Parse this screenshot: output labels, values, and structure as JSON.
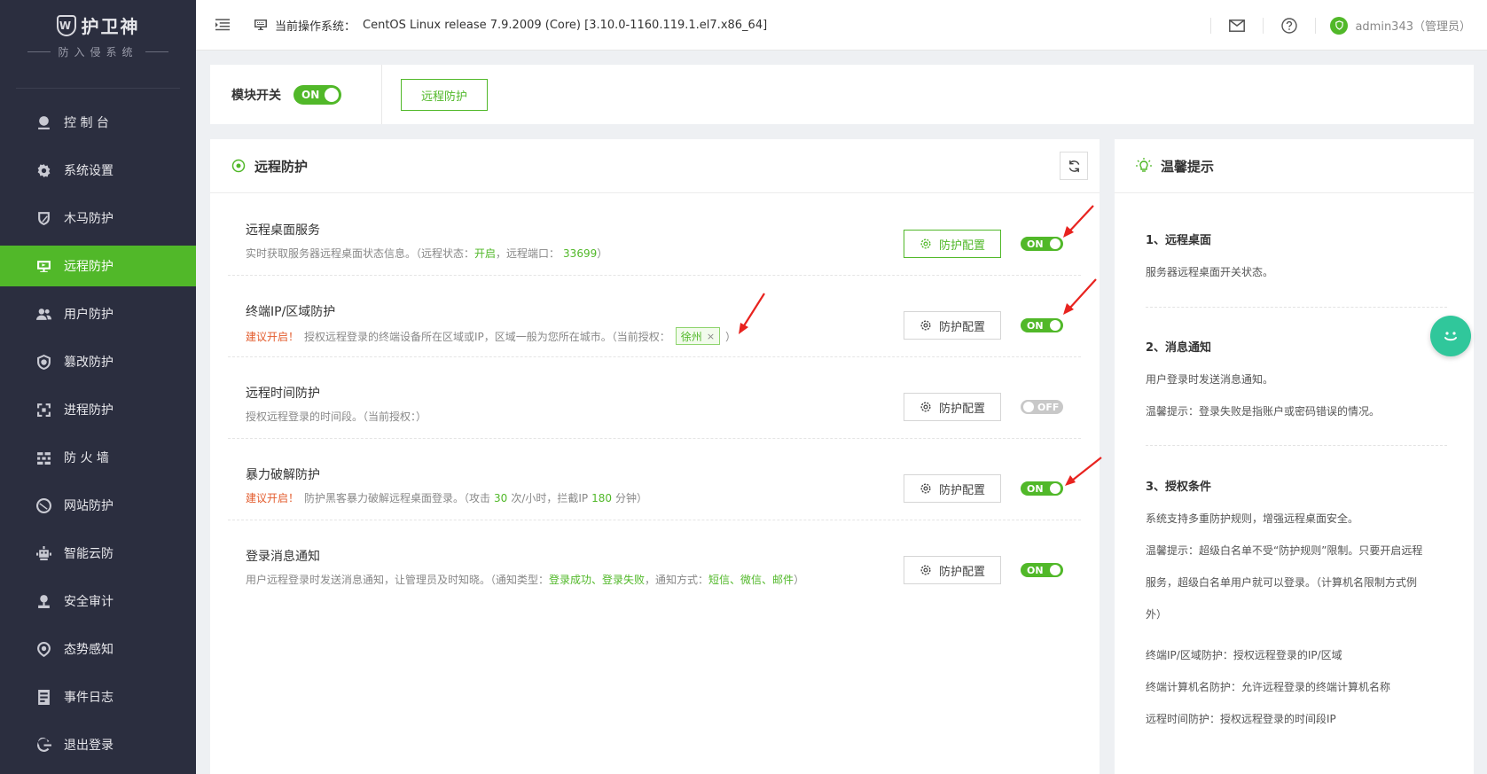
{
  "sidebar": {
    "logo_title": "护卫神",
    "logo_mark": "W",
    "logo_sub": "防入侵系统",
    "items": [
      {
        "label": "控 制 台",
        "icon": "dashboard-icon"
      },
      {
        "label": "系统设置",
        "icon": "gear-icon"
      },
      {
        "label": "木马防护",
        "icon": "trojan-shield-icon"
      },
      {
        "label": "远程防护",
        "icon": "remote-desktop-icon",
        "active": true
      },
      {
        "label": "用户防护",
        "icon": "users-icon"
      },
      {
        "label": "篡改防护",
        "icon": "tamper-icon"
      },
      {
        "label": "进程防护",
        "icon": "process-icon"
      },
      {
        "label": "防 火 墙",
        "icon": "firewall-icon"
      },
      {
        "label": "网站防护",
        "icon": "website-icon"
      },
      {
        "label": "智能云防",
        "icon": "cloud-robot-icon"
      },
      {
        "label": "安全审计",
        "icon": "audit-icon"
      },
      {
        "label": "态势感知",
        "icon": "situation-icon"
      },
      {
        "label": "事件日志",
        "icon": "log-icon"
      },
      {
        "label": "退出登录",
        "icon": "logout-icon"
      }
    ]
  },
  "topbar": {
    "os_label": "当前操作系统：",
    "os_value": "CentOS Linux release 7.9.2009 (Core) [3.10.0-1160.119.1.el7.x86_64]",
    "user": "admin343（管理员）"
  },
  "module": {
    "label": "模块开关",
    "toggle": "ON",
    "tab": "远程防护"
  },
  "panel": {
    "title": "远程防护",
    "config_label": "防护配置",
    "services": [
      {
        "name": "远程桌面服务",
        "desc_a": "实时获取服务器远程桌面状态信息。（远程状态：",
        "status": "开启",
        "desc_b": "，远程端口：",
        "port": "33699",
        "desc_c": "）",
        "toggle": "ON"
      },
      {
        "name": "终端IP/区域防护",
        "warn": "建议开启！",
        "desc_a": "授权远程登录的终端设备所在区域或IP，区域一般为您所在城市。（当前授权：",
        "tag": "徐州",
        "tag_x": "×",
        "desc_c": "）",
        "toggle": "ON"
      },
      {
        "name": "远程时间防护",
        "desc_a": "授权远程登录的时间段。（当前授权：）",
        "toggle": "OFF"
      },
      {
        "name": "暴力破解防护",
        "warn": "建议开启！",
        "desc_a": "防护黑客暴力破解远程桌面登录。（攻击",
        "n1": "30",
        "desc_b": "次/小时，拦截IP",
        "n2": "180",
        "desc_c": "分钟）",
        "toggle": "ON"
      },
      {
        "name": "登录消息通知",
        "desc_a": "用户远程登录时发送消息通知，让管理员及时知晓。（通知类型：",
        "types": "登录成功、登录失败",
        "desc_b": "，通知方式：",
        "ways": "短信、微信、邮件",
        "desc_c": "）",
        "toggle": "ON"
      }
    ]
  },
  "tips": {
    "title": "温馨提示",
    "s1_h": "1、远程桌面",
    "s1_p1": "服务器远程桌面开关状态。",
    "s2_h": "2、消息通知",
    "s2_p1": "用户登录时发送消息通知。",
    "s2_p2": "温馨提示：登录失败是指账户或密码错误的情况。",
    "s3_h": "3、授权条件",
    "s3_p1": "系统支持多重防护规则，增强远程桌面安全。",
    "s3_p2a": "温馨提示：超级白名单不受“防护规则”限制。只要开启远程",
    "s3_p2b": "服务，超级白名单用户就可以登录。（计算机名限制方式例",
    "s3_p2c": "外）",
    "s3_p3": "终端IP/区域防护：授权远程登录的IP/区域",
    "s3_p4": "终端计算机名防护：允许远程登录的终端计算机名称",
    "s3_p5": "远程时间防护：授权远程登录的时间段IP"
  },
  "colors": {
    "accent": "#51b829",
    "sidebar_bg": "#2b2e3f",
    "warn": "#e35b2c",
    "arrow": "#e8231f",
    "chat": "#30c79b"
  }
}
